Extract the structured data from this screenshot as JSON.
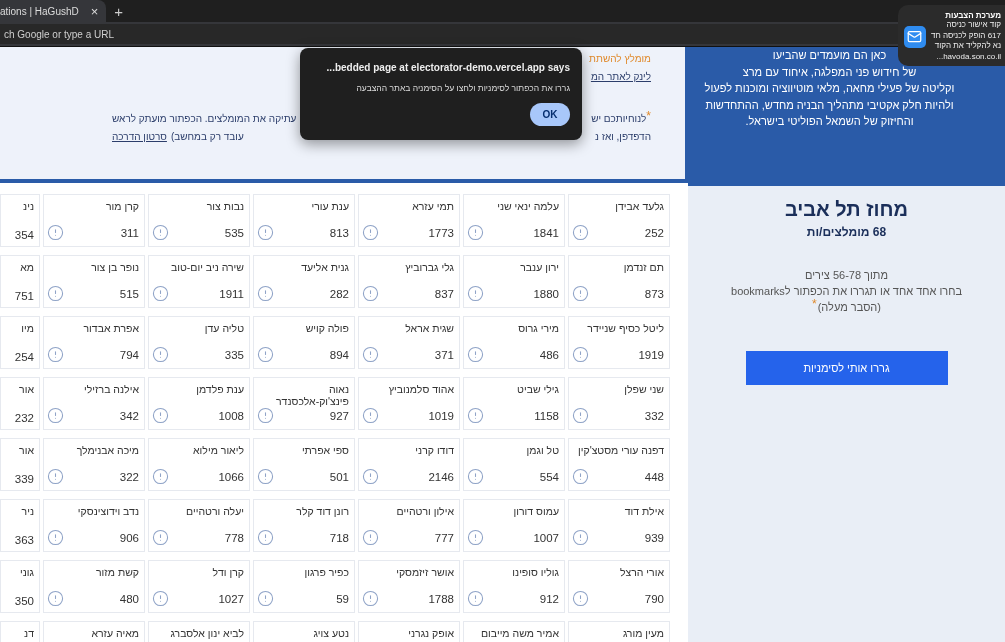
{
  "browser": {
    "tab": {
      "title": "ations | HaGushD",
      "close": "×"
    },
    "new_tab": "+",
    "address_bar": {
      "placeholder": "ch Google or type a URL"
    }
  },
  "notification": {
    "title": "מערכת הצבעות",
    "lines": [
      "קוד אישור כניסה",
      "617 הופק לכניסה חד",
      "נא להקליד את הקוד",
      "havoda.son.co.il..."
    ]
  },
  "info": {
    "lines": [
      {
        "kind": "note",
        "right": "מומלץ להשתת"
      },
      {
        "kind": "link",
        "right": "לינק לאתר המ"
      },
      {
        "kind": "text",
        "star": "*",
        "right": "לנוחיותכם יש",
        "left": "עתיקה את המומלצים. הכפתור מועתק לראש"
      },
      {
        "kind": "text",
        "right": "הדפדפן, ואז נ",
        "left": "עובד רק במחשב)",
        "left_link": "סרטון הדרכה"
      }
    ]
  },
  "dialog": {
    "title": "...bedded page at electorator-demo.vercel.app says",
    "message": "גררו את הכפתור לסימניות ולחצו על הסימניה באתר ההצבעה",
    "button": "OK"
  },
  "candidates": {
    "rows": [
      [
        {
          "name": "גלעד אבידן",
          "votes": "252"
        },
        {
          "name": "עלמה ינאי שני",
          "votes": "1841"
        },
        {
          "name": "תמי עזרא",
          "votes": "1773"
        },
        {
          "name": "ענת עורי",
          "votes": "813"
        },
        {
          "name": "נבות צור",
          "votes": "535"
        },
        {
          "name": "קרן מור",
          "votes": "311"
        },
        {
          "name": "נינ",
          "votes": "354"
        }
      ],
      [
        {
          "name": "תם זנדמן",
          "votes": "873"
        },
        {
          "name": "ירון ענבר",
          "votes": "1880"
        },
        {
          "name": "גלי גברוביץ",
          "votes": "837"
        },
        {
          "name": "גנית אליעד",
          "votes": "282"
        },
        {
          "name": "שירה ניב יום-טוב",
          "votes": "1911"
        },
        {
          "name": "נופר בן צור",
          "votes": "515"
        },
        {
          "name": "מא",
          "votes": "751"
        }
      ],
      [
        {
          "name": "ליטל כסיף שניידר",
          "votes": "1919"
        },
        {
          "name": "מירי גרוס",
          "votes": "486"
        },
        {
          "name": "שגית אראל",
          "votes": "371"
        },
        {
          "name": "פולה קויש",
          "votes": "894"
        },
        {
          "name": "טליה עדן",
          "votes": "335"
        },
        {
          "name": "אפרת אבדור",
          "votes": "794"
        },
        {
          "name": "מיו",
          "votes": "254"
        }
      ],
      [
        {
          "name": "שני שפלן",
          "votes": "332"
        },
        {
          "name": "גילי שביט",
          "votes": "1158"
        },
        {
          "name": "אהוד סלמנוביץ",
          "votes": "1019"
        },
        {
          "name": "נאוה פינצ'וק-אלכסנדר",
          "votes": "927"
        },
        {
          "name": "ענת פלדמן",
          "votes": "1008"
        },
        {
          "name": "אילנה ברזילי",
          "votes": "342"
        },
        {
          "name": "אור",
          "votes": "232"
        }
      ],
      [
        {
          "name": "דפנה עורי מסטצ'קין",
          "votes": "448"
        },
        {
          "name": "טל וגמן",
          "votes": "554"
        },
        {
          "name": "דודו קרני",
          "votes": "2146"
        },
        {
          "name": "ספי אפרתי",
          "votes": "501"
        },
        {
          "name": "ליאור מילוא",
          "votes": "1066"
        },
        {
          "name": "מיכה אבנימלך",
          "votes": "322"
        },
        {
          "name": "אור",
          "votes": "339"
        }
      ],
      [
        {
          "name": "אילת דוד",
          "votes": "939"
        },
        {
          "name": "עמוס דורון",
          "votes": "1007"
        },
        {
          "name": "אילון ורטהיים",
          "votes": "777"
        },
        {
          "name": "רונן דוד קלר",
          "votes": "718"
        },
        {
          "name": "יעלה ורטהיים",
          "votes": "778"
        },
        {
          "name": "נדב וידוצינסקי",
          "votes": "906"
        },
        {
          "name": "ניר",
          "votes": "363"
        }
      ],
      [
        {
          "name": "אורי הרצל",
          "votes": "790"
        },
        {
          "name": "גוליו סופינו",
          "votes": "912"
        },
        {
          "name": "אושר זיזמסקי",
          "votes": "1788"
        },
        {
          "name": "כפיר פרגון",
          "votes": "59"
        },
        {
          "name": "קרן ודל",
          "votes": "1027"
        },
        {
          "name": "קשת מזור",
          "votes": "480"
        },
        {
          "name": "גוני",
          "votes": "350"
        }
      ],
      [
        {
          "name": "מעין מורג"
        },
        {
          "name": "אמיר משה מייבום"
        },
        {
          "name": "אופק נגרני"
        },
        {
          "name": "נטע צויג"
        },
        {
          "name": "לביא ינון אלסברג"
        },
        {
          "name": "מאיה עזרא"
        },
        {
          "name": "דנ"
        }
      ]
    ]
  },
  "sidebar": {
    "intro_lines": [
      "כאן הם מועמדים שהביעו",
      "של חידוש פני המפלגה, איחוד עם מרצ",
      "וקליטה של פעילי מחאה, מלאי מוטיווציה ומוכנות לפעול",
      "ולהיות חלק אקטיבי מתהליך הבניה מחדש, ההתחדשות",
      "והחיזוק של השמאל הפוליטי בישראל."
    ],
    "district": "מחוז תל אביב",
    "count": "68 מומלצים/ות",
    "range": "מתוך 56-78 צירים",
    "instruction": "בחרו אחד אחד או תגררו את הכפתור לbookmarks",
    "star": "*",
    "hint": "(הסבר מעלה)",
    "button": "גררו אותי לסימניות"
  }
}
